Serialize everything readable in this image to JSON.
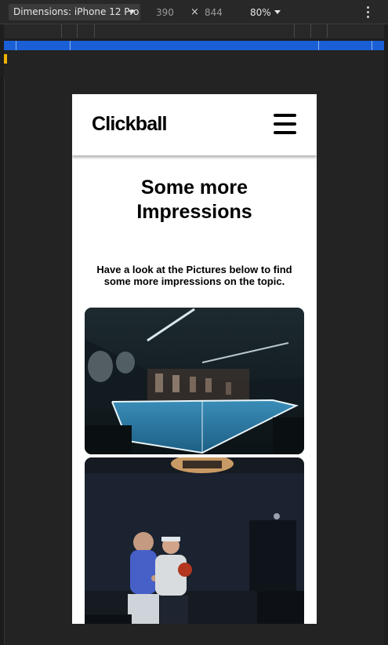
{
  "devtools": {
    "device_label": "Dimensions: iPhone 12 Pro",
    "width_value": "390",
    "height_value": "844",
    "dim_separator": "×",
    "zoom_label": "80%"
  },
  "page": {
    "logo": "Clickball",
    "title_line1": "Some more",
    "title_line2": "Impressions",
    "subtitle": "Have a look at the Pictures below to find some more impressions on the topic."
  },
  "colors": {
    "accent_bar": "#1a5fd6",
    "table_blue": "#2f7fae"
  }
}
